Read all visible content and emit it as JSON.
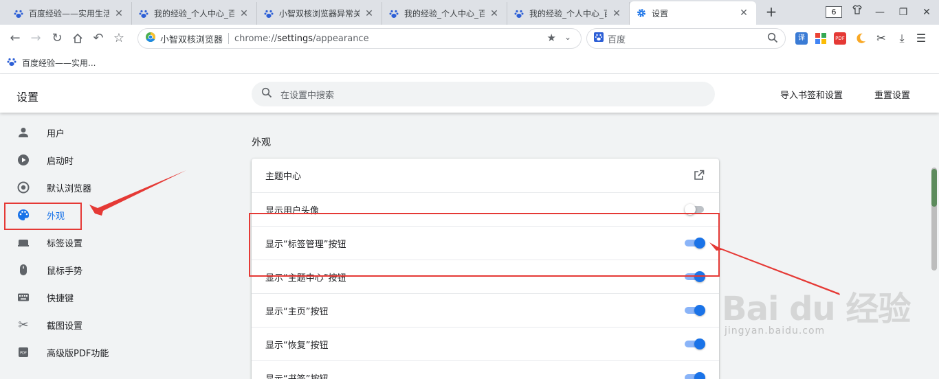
{
  "tabs": [
    {
      "title": "百度经验——实用生活",
      "favicon": "baidu-paw-icon",
      "active": false
    },
    {
      "title": "我的经验_个人中心_百",
      "favicon": "baidu-paw-icon",
      "active": false
    },
    {
      "title": "小智双核浏览器异常关",
      "favicon": "baidu-paw-icon",
      "active": false
    },
    {
      "title": "我的经验_个人中心_百",
      "favicon": "baidu-paw-icon",
      "active": false
    },
    {
      "title": "我的经验_个人中心_百",
      "favicon": "baidu-paw-icon",
      "active": false
    },
    {
      "title": "设置",
      "favicon": "gear-icon",
      "active": true
    }
  ],
  "tabstrip": {
    "new_tab": "+",
    "tab_count": "6",
    "close": "✕",
    "minimize": "—",
    "maximize": "❐"
  },
  "toolbar": {
    "browser_name": "小智双核浏览器",
    "url_scheme": "chrome://",
    "url_host": "settings",
    "url_path": "/appearance",
    "search_engine": "百度",
    "ext_translate": "译",
    "ext_pdf": "PDF"
  },
  "bookmarks": [
    {
      "title": "百度经验——实用..."
    }
  ],
  "settings": {
    "title": "设置",
    "search_placeholder": "在设置中搜索",
    "import_link": "导入书签和设置",
    "reset_link": "重置设置"
  },
  "sidebar": {
    "items": [
      {
        "label": "用户",
        "icon": "person-icon",
        "active": false
      },
      {
        "label": "启动时",
        "icon": "power-icon",
        "active": false
      },
      {
        "label": "默认浏览器",
        "icon": "browser-icon",
        "active": false
      },
      {
        "label": "外观",
        "icon": "palette-icon",
        "active": true
      },
      {
        "label": "标签设置",
        "icon": "tab-icon",
        "active": false
      },
      {
        "label": "鼠标手势",
        "icon": "mouse-icon",
        "active": false
      },
      {
        "label": "快捷键",
        "icon": "keyboard-icon",
        "active": false
      },
      {
        "label": "截图设置",
        "icon": "scissors-icon",
        "active": false
      },
      {
        "label": "高级版PDF功能",
        "icon": "pdf-icon",
        "active": false
      }
    ]
  },
  "appearance": {
    "section_title": "外观",
    "rows": [
      {
        "label": "主题中心",
        "control": "link"
      },
      {
        "label": "显示用户头像",
        "control": "toggle",
        "on": false
      },
      {
        "label": "显示“标签管理”按钮",
        "control": "toggle",
        "on": true
      },
      {
        "label": "显示“主题中心”按钮",
        "control": "toggle",
        "on": true
      },
      {
        "label": "显示“主页”按钮",
        "control": "toggle",
        "on": true
      },
      {
        "label": "显示“恢复”按钮",
        "control": "toggle",
        "on": true
      },
      {
        "label": "显示“书签”按钮",
        "control": "toggle",
        "on": true
      }
    ]
  },
  "watermark": {
    "brand": "Bai du 经验",
    "domain": "jingyan.baidu.com"
  },
  "colors": {
    "accent": "#1a73e8",
    "annotation": "#e53935",
    "toggle_off": "#bdc1c6"
  }
}
